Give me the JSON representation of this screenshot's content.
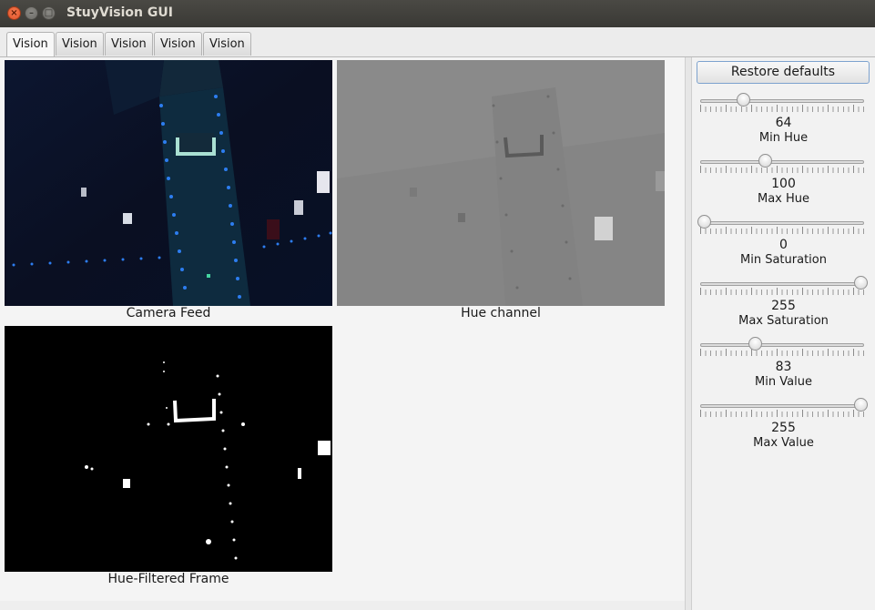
{
  "window": {
    "title": "StuyVision GUI"
  },
  "tabs": [
    {
      "label": "Vision",
      "active": true
    },
    {
      "label": "Vision",
      "active": false
    },
    {
      "label": "Vision",
      "active": false
    },
    {
      "label": "Vision",
      "active": false
    },
    {
      "label": "Vision",
      "active": false
    }
  ],
  "frames": {
    "camera": {
      "caption": "Camera Feed"
    },
    "hue": {
      "caption": "Hue channel"
    },
    "filtered": {
      "caption": "Hue-Filtered Frame"
    }
  },
  "controls": {
    "restore_label": "Restore defaults",
    "slider_range": [
      0,
      255
    ],
    "sliders": [
      {
        "label": "Min Hue",
        "value": 64
      },
      {
        "label": "Max Hue",
        "value": 100
      },
      {
        "label": "Min Saturation",
        "value": 0
      },
      {
        "label": "Max Saturation",
        "value": 255
      },
      {
        "label": "Min Value",
        "value": 83
      },
      {
        "label": "Max Value",
        "value": 255
      }
    ]
  },
  "colors": {
    "accent": "#7da2ce",
    "titlebar": "#3c3b37",
    "close": "#e2532a"
  }
}
